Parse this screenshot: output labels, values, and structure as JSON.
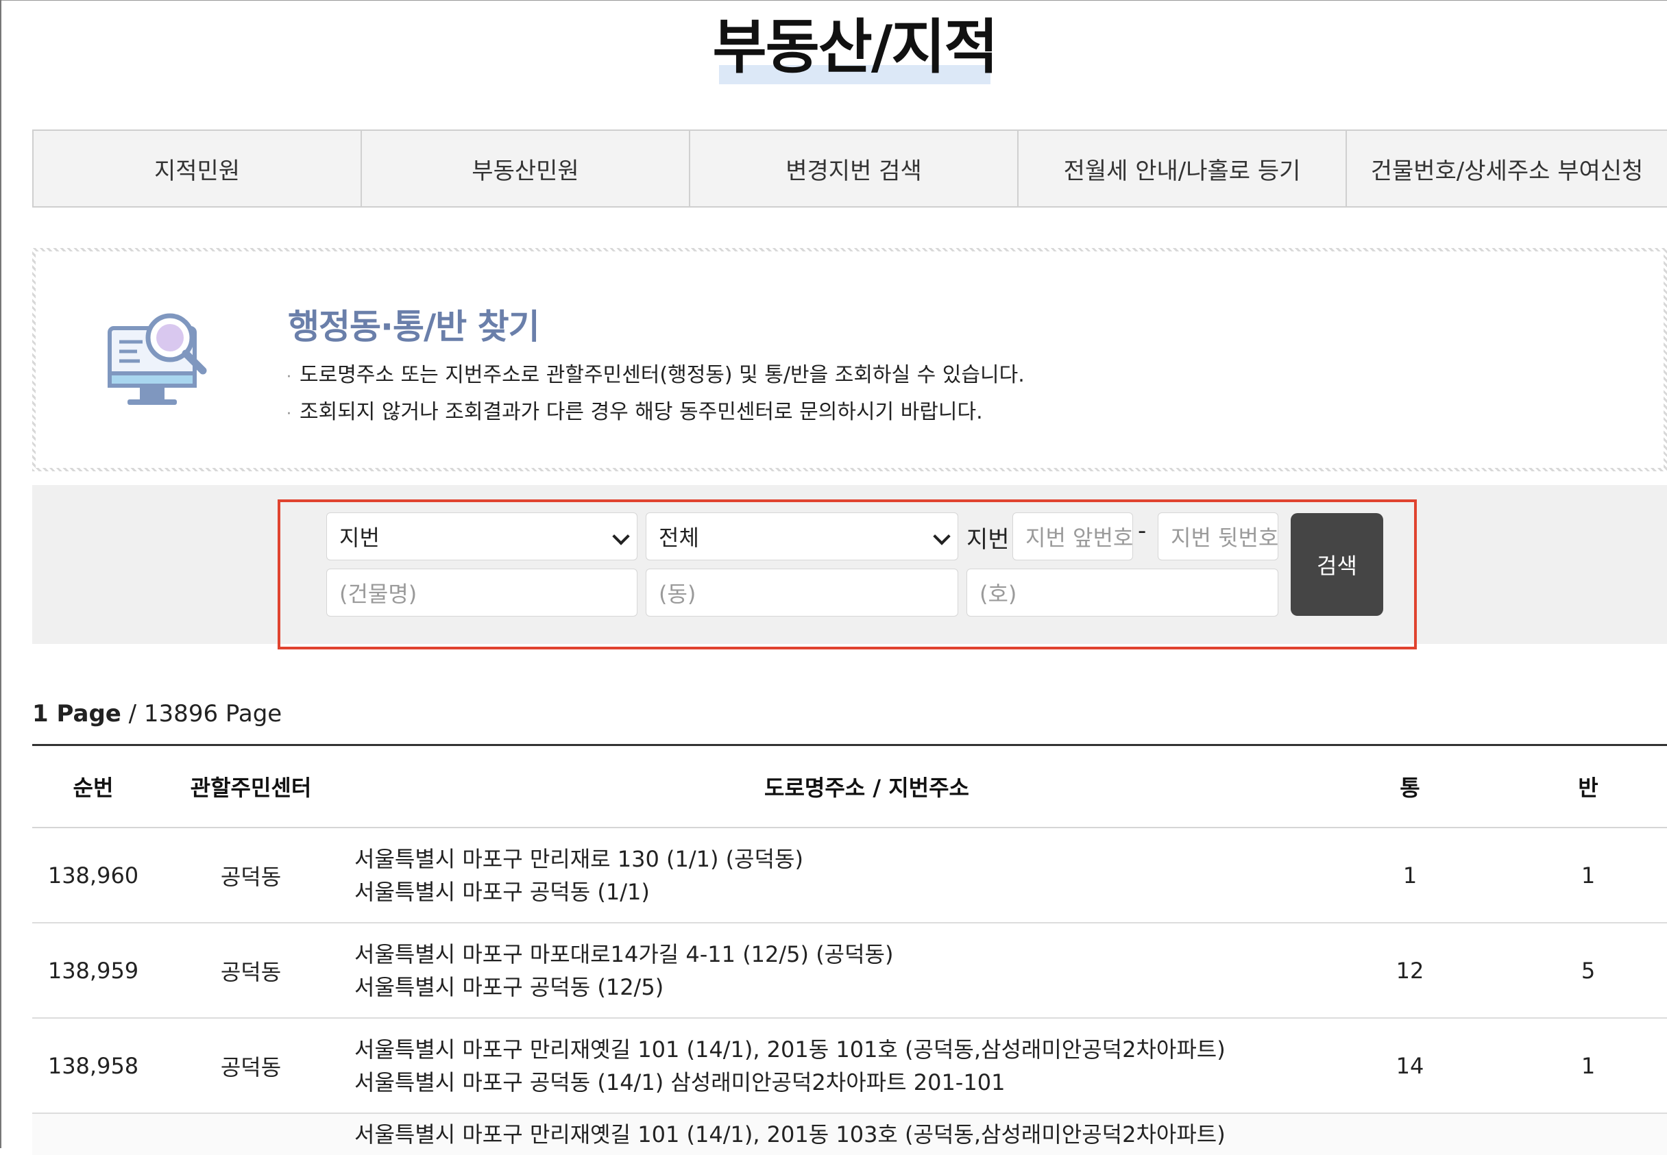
{
  "page_title": "부동산/지적",
  "tabs": [
    {
      "label": "지적민원"
    },
    {
      "label": "부동산민원"
    },
    {
      "label": "변경지번 검색"
    },
    {
      "label": "전월세 안내/나홀로 등기"
    },
    {
      "label": "건물번호/상세주소 부여신청"
    }
  ],
  "info": {
    "title": "행정동·통/반 찾기",
    "lines": [
      "도로명주소 또는 지번주소로 관할주민센터(행정동) 및 통/반을 조회하실 수 있습니다.",
      "조회되지 않거나 조회결과가 다른 경우 해당 동주민센터로 문의하시기 바랍니다."
    ]
  },
  "search": {
    "type_select": "지번",
    "area_select": "전체",
    "jibun_label": "지번",
    "jibun_main_placeholder": "지번 앞번호",
    "dash": "-",
    "jibun_sub_placeholder": "지번 뒷번호",
    "building_placeholder": "(건물명)",
    "dong_placeholder": "(동)",
    "ho_placeholder": "(호)",
    "button_label": "검색"
  },
  "paging": {
    "current": "1 Page",
    "separator": " / ",
    "total": "13896 Page"
  },
  "table": {
    "headers": {
      "no": "순번",
      "center": "관할주민센터",
      "address": "도로명주소 / 지번주소",
      "tong": "통",
      "ban": "반"
    },
    "rows": [
      {
        "no": "138,960",
        "center": "공덕동",
        "road": "서울특별시 마포구 만리재로 130 (1/1) (공덕동)",
        "jibun": "서울특별시 마포구 공덕동 (1/1)",
        "tong": "1",
        "ban": "1"
      },
      {
        "no": "138,959",
        "center": "공덕동",
        "road": "서울특별시 마포구 마포대로14가길 4-11 (12/5) (공덕동)",
        "jibun": "서울특별시 마포구 공덕동 (12/5)",
        "tong": "12",
        "ban": "5"
      },
      {
        "no": "138,958",
        "center": "공덕동",
        "road": "서울특별시 마포구 만리재옛길 101 (14/1), 201동 101호 (공덕동,삼성래미안공덕2차아파트)",
        "jibun": "서울특별시 마포구 공덕동 (14/1) 삼성래미안공덕2차아파트 201-101",
        "tong": "14",
        "ban": "1"
      },
      {
        "no": "",
        "center": "",
        "road": "서울특별시 마포구 만리재옛길 101 (14/1), 201동 103호 (공덕동,삼성래미안공덕2차아파트)",
        "jibun": "",
        "tong": "",
        "ban": ""
      }
    ]
  },
  "colors": {
    "accent_title": "#6a7faa",
    "highlight_box": "#e0432f",
    "search_button": "#454545"
  }
}
